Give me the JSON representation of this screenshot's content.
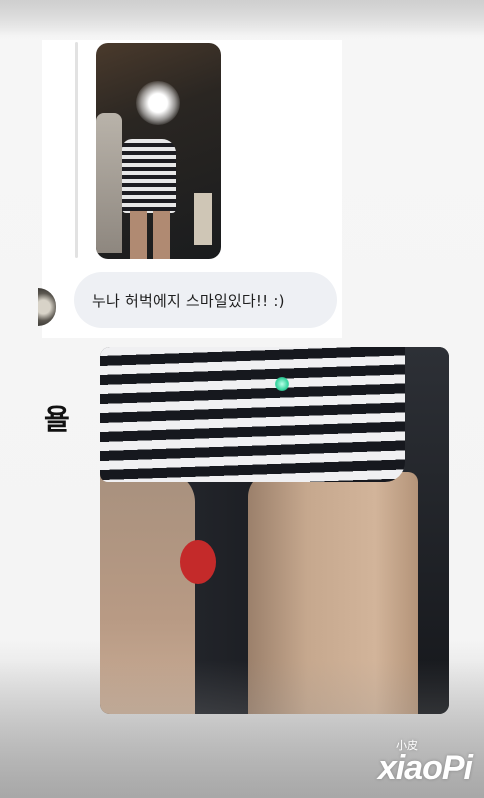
{
  "messages": {
    "reply_text": "누나 허벅에지 스마일있다!! :)",
    "side_text": "욜"
  },
  "watermark": {
    "small": "小皮",
    "big": "xiaoPi"
  },
  "colors": {
    "bubble": "#eef0f4",
    "card": "#ffffff",
    "text": "#1f1f1f"
  }
}
